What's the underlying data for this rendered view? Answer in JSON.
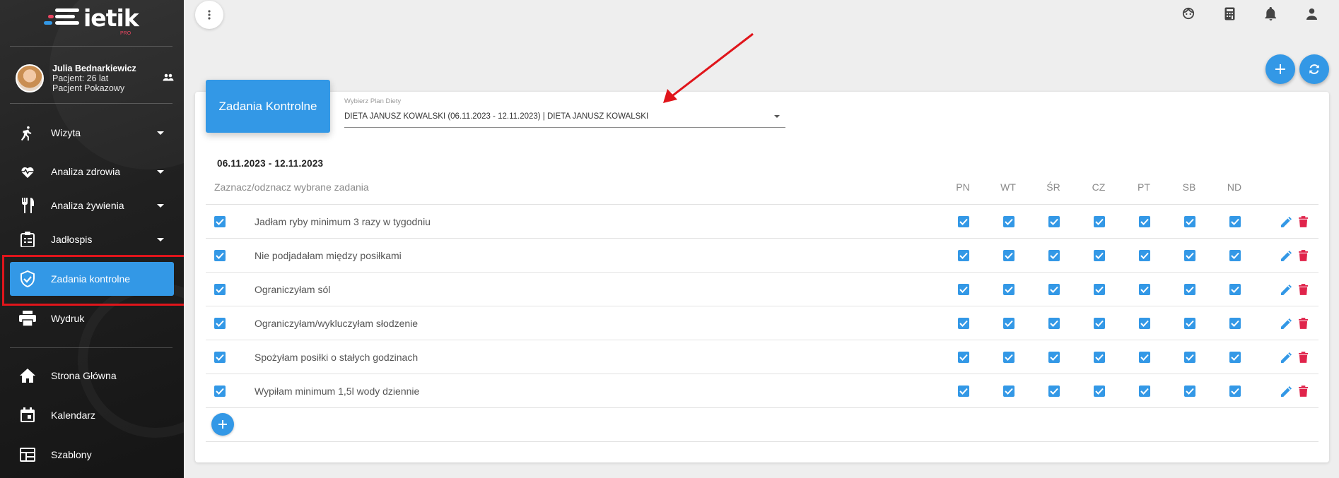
{
  "app": {
    "logo_text": "ietik",
    "logo_pro": "PRO"
  },
  "user": {
    "name": "Julia Bednarkiewicz",
    "age": "Pacjent: 26 lat",
    "status": "Pacjent Pokazowy"
  },
  "sidebar": {
    "items": [
      {
        "label": "Wizyta",
        "icon": "walk-icon",
        "has_caret": true,
        "active": false
      },
      {
        "label": "Analiza zdrowia",
        "icon": "heart-pulse-icon",
        "has_caret": true,
        "active": false
      },
      {
        "label": "Analiza żywienia",
        "icon": "fork-knife-icon",
        "has_caret": true,
        "active": false
      },
      {
        "label": "Jadłospis",
        "icon": "clipboard-list-icon",
        "has_caret": true,
        "active": false
      },
      {
        "label": "Zadania kontrolne",
        "icon": "shield-check-icon",
        "has_caret": false,
        "active": true
      },
      {
        "label": "Wydruk",
        "icon": "printer-icon",
        "has_caret": false,
        "active": false
      },
      {
        "label": "Strona Główna",
        "icon": "home-icon",
        "has_caret": false,
        "active": false
      },
      {
        "label": "Kalendarz",
        "icon": "calendar-icon",
        "has_caret": false,
        "active": false
      },
      {
        "label": "Szablony",
        "icon": "template-icon",
        "has_caret": false,
        "active": false
      }
    ]
  },
  "topbar": {
    "icons": [
      "face-icon",
      "calculator-icon",
      "bell-icon",
      "account-icon"
    ]
  },
  "card": {
    "title": "Zadania Kontrolne",
    "select_label": "Wybierz Plan Diety",
    "select_value": "DIETA JANUSZ KOWALSKI (06.11.2023 - 12.11.2023) | DIETA JANUSZ KOWALSKI",
    "date_range": "06.11.2023 - 12.11.2023",
    "toggle_label": "Zaznacz/odznacz wybrane zadania",
    "days": [
      "PN",
      "WT",
      "ŚR",
      "CZ",
      "PT",
      "SB",
      "ND"
    ],
    "tasks": [
      {
        "label": "Jadłam ryby minimum 3 razy w tygodniu",
        "checked": true,
        "days": [
          true,
          true,
          true,
          true,
          true,
          true,
          true
        ]
      },
      {
        "label": "Nie podjadałam między posiłkami",
        "checked": true,
        "days": [
          true,
          true,
          true,
          true,
          true,
          true,
          true
        ]
      },
      {
        "label": "Ograniczyłam sól",
        "checked": true,
        "days": [
          true,
          true,
          true,
          true,
          true,
          true,
          true
        ]
      },
      {
        "label": "Ograniczyłam/wykluczyłam słodzenie",
        "checked": true,
        "days": [
          true,
          true,
          true,
          true,
          true,
          true,
          true
        ]
      },
      {
        "label": "Spożyłam posiłki o stałych godzinach",
        "checked": true,
        "days": [
          true,
          true,
          true,
          true,
          true,
          true,
          true
        ]
      },
      {
        "label": "Wypiłam minimum 1,5l wody dziennie",
        "checked": true,
        "days": [
          true,
          true,
          true,
          true,
          true,
          true,
          true
        ]
      }
    ]
  },
  "colors": {
    "accent": "#3398e6",
    "delete": "#e0244b",
    "highlight": "#e0151b",
    "sidebar_bg": "#222222"
  }
}
